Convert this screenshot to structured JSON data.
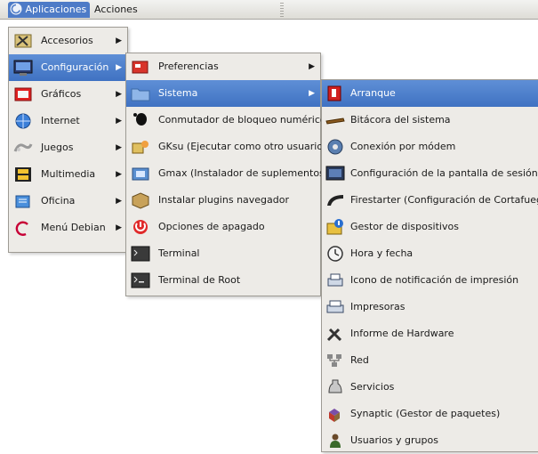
{
  "panel": {
    "applications": "Aplicaciones",
    "actions": "Acciones"
  },
  "main_menu": [
    {
      "label": "Accesorios",
      "icon": "accessories-icon",
      "submenu": true
    },
    {
      "label": "Configuración",
      "icon": "settings-icon",
      "submenu": true,
      "selected": true
    },
    {
      "label": "Gráficos",
      "icon": "graphics-icon",
      "submenu": true
    },
    {
      "label": "Internet",
      "icon": "internet-icon",
      "submenu": true
    },
    {
      "label": "Juegos",
      "icon": "games-icon",
      "submenu": true
    },
    {
      "label": "Multimedia",
      "icon": "multimedia-icon",
      "submenu": true
    },
    {
      "label": "Oficina",
      "icon": "office-icon",
      "submenu": true
    },
    {
      "label": "Menú Debian",
      "icon": "debian-icon",
      "submenu": true
    }
  ],
  "config_menu": [
    {
      "label": "Preferencias",
      "icon": "preferences-icon",
      "submenu": true
    },
    {
      "label": "Sistema",
      "icon": "folder-icon",
      "submenu": true,
      "selected": true
    },
    {
      "label": "Conmutador de bloqueo numérico",
      "icon": "gnome-foot-icon"
    },
    {
      "label": "GKsu (Ejecutar como otro usuario)",
      "icon": "gksu-icon"
    },
    {
      "label": "Gmax (Instalador de suplementos)",
      "icon": "gmax-icon"
    },
    {
      "label": "Instalar plugins navegador",
      "icon": "package-icon"
    },
    {
      "label": "Opciones de apagado",
      "icon": "power-icon"
    },
    {
      "label": "Terminal",
      "icon": "terminal-icon"
    },
    {
      "label": "Terminal de Root",
      "icon": "root-terminal-icon"
    }
  ],
  "system_menu": [
    {
      "label": "Arranque",
      "icon": "boot-switch-icon",
      "selected": true
    },
    {
      "label": "Bitácora del sistema",
      "icon": "log-icon"
    },
    {
      "label": "Conexión por módem",
      "icon": "modem-icon"
    },
    {
      "label": "Configuración de la pantalla de sesión",
      "icon": "login-screen-icon"
    },
    {
      "label": "Firestarter (Configuración de Cortafuegos)",
      "icon": "firewall-icon"
    },
    {
      "label": "Gestor de dispositivos",
      "icon": "device-manager-icon"
    },
    {
      "label": "Hora y fecha",
      "icon": "clock-icon"
    },
    {
      "label": "Icono de notificación de impresión",
      "icon": "print-notify-icon"
    },
    {
      "label": "Impresoras",
      "icon": "printer-icon"
    },
    {
      "label": "Informe de Hardware",
      "icon": "hardware-icon"
    },
    {
      "label": "Red",
      "icon": "network-icon"
    },
    {
      "label": "Servicios",
      "icon": "services-icon"
    },
    {
      "label": "Synaptic (Gestor de paquetes)",
      "icon": "synaptic-icon"
    },
    {
      "label": "Usuarios y grupos",
      "icon": "users-icon"
    }
  ],
  "colors": {
    "selection": "#4d7bc7",
    "menu_bg": "#edebe7",
    "panel_bg": "#e6e4df"
  }
}
